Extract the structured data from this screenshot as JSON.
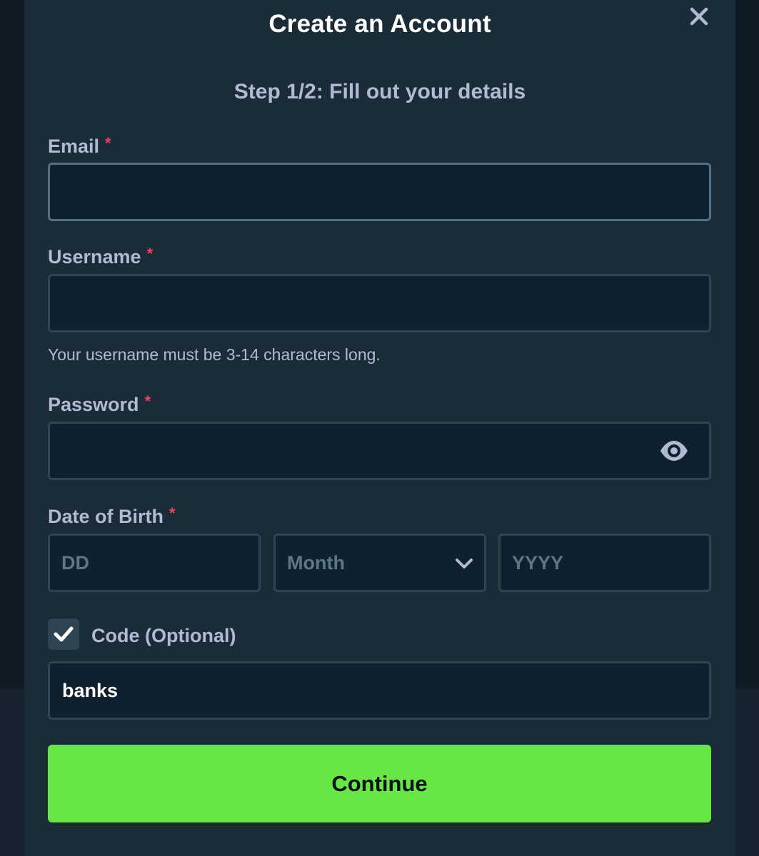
{
  "modal": {
    "title": "Create an Account",
    "step": "Step 1/2: Fill out your details"
  },
  "icons": {
    "close": "close-icon",
    "eye": "eye-icon",
    "chevron": "chevron-down-icon",
    "check": "checkmark-icon"
  },
  "form": {
    "email": {
      "label": "Email",
      "required_mark": "*",
      "value": "",
      "placeholder": ""
    },
    "username": {
      "label": "Username",
      "required_mark": "*",
      "value": "",
      "placeholder": "",
      "hint": "Your username must be 3-14 characters long."
    },
    "password": {
      "label": "Password",
      "required_mark": "*",
      "value": "",
      "placeholder": ""
    },
    "dob": {
      "label": "Date of Birth",
      "required_mark": "*",
      "day_placeholder": "DD",
      "month_placeholder": "Month",
      "year_placeholder": "YYYY"
    },
    "code": {
      "checked": true,
      "label": "Code (Optional)",
      "value": "banks"
    },
    "continue_label": "Continue"
  },
  "colors": {
    "modal_bg": "#1a2c38",
    "input_bg": "#0f212e",
    "input_border": "#2f4553",
    "label": "#b1bad3",
    "required": "#ed4163",
    "accent_green": "#67e645"
  }
}
